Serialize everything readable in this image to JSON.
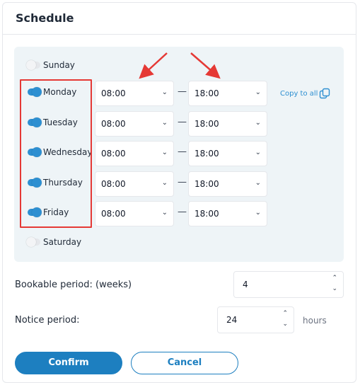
{
  "header": {
    "title": "Schedule"
  },
  "schedule": {
    "days": [
      {
        "name": "Sunday",
        "enabled": false
      },
      {
        "name": "Monday",
        "enabled": true,
        "start": "08:00",
        "end": "18:00"
      },
      {
        "name": "Tuesday",
        "enabled": true,
        "start": "08:00",
        "end": "18:00"
      },
      {
        "name": "Wednesday",
        "enabled": true,
        "start": "08:00",
        "end": "18:00"
      },
      {
        "name": "Thursday",
        "enabled": true,
        "start": "08:00",
        "end": "18:00"
      },
      {
        "name": "Friday",
        "enabled": true,
        "start": "08:00",
        "end": "18:00"
      },
      {
        "name": "Saturday",
        "enabled": false
      }
    ],
    "copy_label": "Copy to all",
    "separator": "—"
  },
  "bookable": {
    "label": "Bookable period: (weeks)",
    "value": "4"
  },
  "notice": {
    "label": "Notice period:",
    "value": "24",
    "units": "hours"
  },
  "actions": {
    "confirm_label": "Confirm",
    "cancel_label": "Cancel"
  },
  "colors": {
    "accent": "#1d7fc0",
    "toggle_on": "#2d8fd1",
    "annotation": "#e53935",
    "panel_bg": "#eef4f7"
  },
  "icons": {
    "copy": "copy-icon",
    "chevron": "chevron-down-icon",
    "spinner": "spinner-up-down-icon"
  }
}
